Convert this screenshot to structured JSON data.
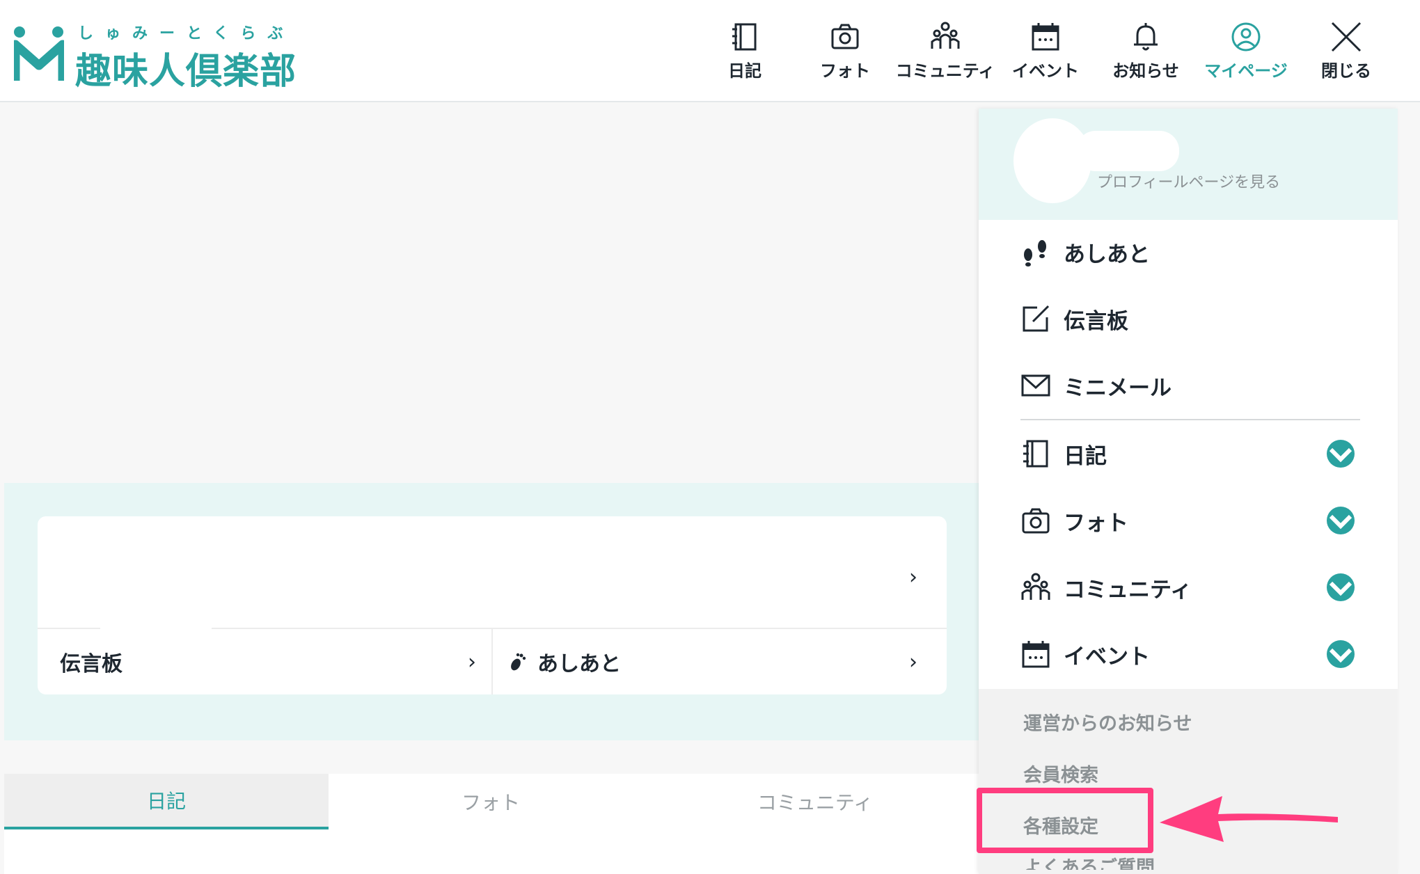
{
  "brand": {
    "kana": "しゅみーとくらぶ",
    "title": "趣味人倶楽部",
    "color": "#2aa2a0"
  },
  "nav": [
    {
      "label": "日記",
      "icon": "notebook-icon"
    },
    {
      "label": "フォト",
      "icon": "camera-icon"
    },
    {
      "label": "コミュニティ",
      "icon": "community-icon"
    },
    {
      "label": "イベント",
      "icon": "calendar-icon"
    },
    {
      "label": "お知らせ",
      "icon": "bell-icon"
    },
    {
      "label": "マイページ",
      "icon": "user-circle-icon",
      "active": true
    },
    {
      "label": "閉じる",
      "icon": "close-icon"
    }
  ],
  "card": {
    "bulletin_label": "伝言板",
    "footprints_label": "あしあと"
  },
  "tabs": [
    {
      "label": "日記",
      "active": true
    },
    {
      "label": "フォト",
      "active": false
    },
    {
      "label": "コミュニティ",
      "active": false
    }
  ],
  "panel": {
    "profile_link": "プロフィールページを見る",
    "menu": [
      {
        "label": "あしあと",
        "icon": "footprints-icon"
      },
      {
        "label": "伝言板",
        "icon": "edit-note-icon"
      },
      {
        "label": "ミニメール",
        "icon": "mail-icon"
      },
      {
        "label": "日記",
        "icon": "notebook-icon",
        "expandable": true
      },
      {
        "label": "フォト",
        "icon": "camera-icon",
        "expandable": true
      },
      {
        "label": "コミュニティ",
        "icon": "community-icon",
        "expandable": true
      },
      {
        "label": "イベント",
        "icon": "calendar-icon",
        "expandable": true
      }
    ],
    "sub_links": [
      {
        "label": "運営からのお知らせ"
      },
      {
        "label": "会員検索"
      },
      {
        "label": "各種設定",
        "highlighted": true
      },
      {
        "label": "よくあるご質問"
      }
    ]
  },
  "colors": {
    "accent": "#2aa2a0",
    "highlight": "#ff3d7f",
    "band": "#e7f6f5"
  }
}
